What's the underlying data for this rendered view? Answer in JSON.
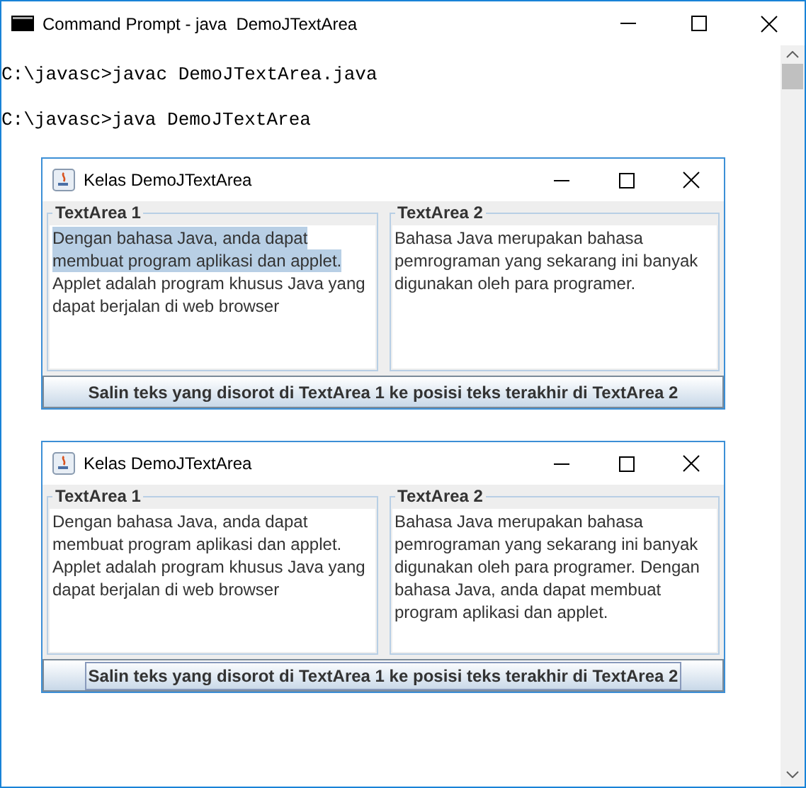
{
  "window": {
    "title": "Command Prompt - java  DemoJTextArea"
  },
  "console": {
    "lines": [
      "C:\\javasc>javac DemoJTextArea.java",
      "C:\\javasc>java DemoJTextArea"
    ]
  },
  "frames": [
    {
      "title": "Kelas DemoJTextArea",
      "areas": [
        {
          "label": "TextArea 1",
          "lines": [
            {
              "text": "Dengan bahasa Java, anda dapat",
              "selected": true
            },
            {
              "text": "membuat program aplikasi dan applet.",
              "selected": true
            },
            {
              "text": "Applet adalah program khusus Java yang",
              "selected": false
            },
            {
              "text": "dapat berjalan di web browser",
              "selected": false
            }
          ]
        },
        {
          "label": "TextArea 2",
          "lines": [
            {
              "text": "Bahasa Java merupakan bahasa",
              "selected": false
            },
            {
              "text": "pemrograman yang sekarang ini banyak",
              "selected": false
            },
            {
              "text": "digunakan oleh para programer.",
              "selected": false
            }
          ]
        }
      ],
      "button": {
        "label": "Salin teks yang disorot di TextArea 1 ke posisi teks terakhir di TextArea 2",
        "focused": false
      }
    },
    {
      "title": "Kelas DemoJTextArea",
      "areas": [
        {
          "label": "TextArea 1",
          "lines": [
            {
              "text": "Dengan bahasa Java, anda dapat",
              "selected": false
            },
            {
              "text": "membuat program aplikasi dan applet.",
              "selected": false
            },
            {
              "text": "Applet adalah program khusus Java yang",
              "selected": false
            },
            {
              "text": "dapat berjalan di web browser",
              "selected": false
            }
          ]
        },
        {
          "label": "TextArea 2",
          "lines": [
            {
              "text": "Bahasa Java merupakan bahasa",
              "selected": false
            },
            {
              "text": "pemrograman yang sekarang ini banyak",
              "selected": false
            },
            {
              "text": "digunakan oleh para programer. Dengan",
              "selected": false
            },
            {
              "text": "bahasa Java, anda dapat membuat",
              "selected": false
            },
            {
              "text": "program aplikasi dan applet.",
              "selected": false
            }
          ]
        }
      ],
      "button": {
        "label": "Salin teks yang disorot di TextArea 1 ke posisi teks terakhir di TextArea 2",
        "focused": true
      }
    }
  ]
}
